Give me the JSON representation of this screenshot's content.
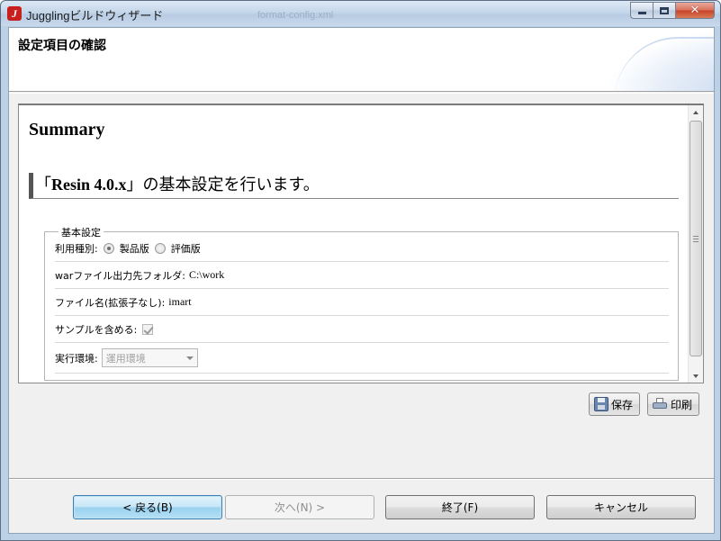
{
  "window": {
    "title": "Jugglingビルドウィザード",
    "ghost_tab": "format-config.xml",
    "controls": {
      "minimize_icon": "minimize-icon",
      "maximize_icon": "maximize-icon",
      "close_icon": "close-icon",
      "close_glyph": "✕"
    },
    "app_icon_glyph": "J"
  },
  "header": {
    "title": "設定項目の確認"
  },
  "summary": {
    "heading": "Summary",
    "section_open": "「",
    "section_product": "Resin 4.0.x",
    "section_close": "」",
    "section_rest": "の基本設定を行います。",
    "group_legend": "基本設定",
    "rows": {
      "usage_label": "利用種別:",
      "usage_options": [
        "製品版",
        "評価版"
      ],
      "usage_selected": "製品版",
      "war_label": "warファイル出力先フォルダ:",
      "war_value": "C:\\work",
      "filename_label": "ファイル名(拡張子なし):",
      "filename_value": "imart",
      "sample_label": "サンプルを含める:",
      "sample_checked": true,
      "env_label": "実行環境:",
      "env_value": "運用環境"
    }
  },
  "tools": {
    "save_label": "保存",
    "print_label": "印刷"
  },
  "nav": {
    "back_label": "< 戻る(B)",
    "next_label": "次へ(N) >",
    "finish_label": "終了(F)",
    "cancel_label": "キャンセル"
  },
  "colors": {
    "window_frame": "#bcd0e6",
    "focus_button": "#98d1ef",
    "close_button": "#c8432a"
  }
}
